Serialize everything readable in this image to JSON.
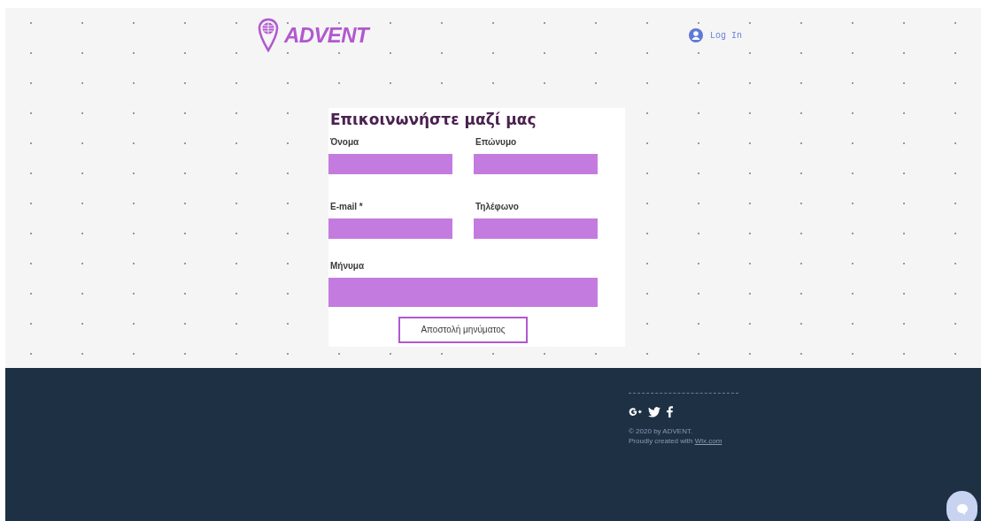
{
  "header": {
    "logo": "ADVENT",
    "login": "Log In"
  },
  "form": {
    "title": "Επικοινωνήστε μαζί μας",
    "fields": [
      {
        "label": "Όνομα",
        "kind": "input"
      },
      {
        "label": "Επώνυμο",
        "kind": "input"
      },
      {
        "label": "E-mail *",
        "kind": "input"
      },
      {
        "label": "Τηλέφωνο",
        "kind": "input"
      },
      {
        "label": "Μήνυμα",
        "kind": "textarea"
      }
    ],
    "submit": "Αποστολή μηνύματος"
  },
  "footer": {
    "copyright": "© 2020 by ADVENT.",
    "credit": "Proudly created with ",
    "credit_link": "Wix.com"
  }
}
